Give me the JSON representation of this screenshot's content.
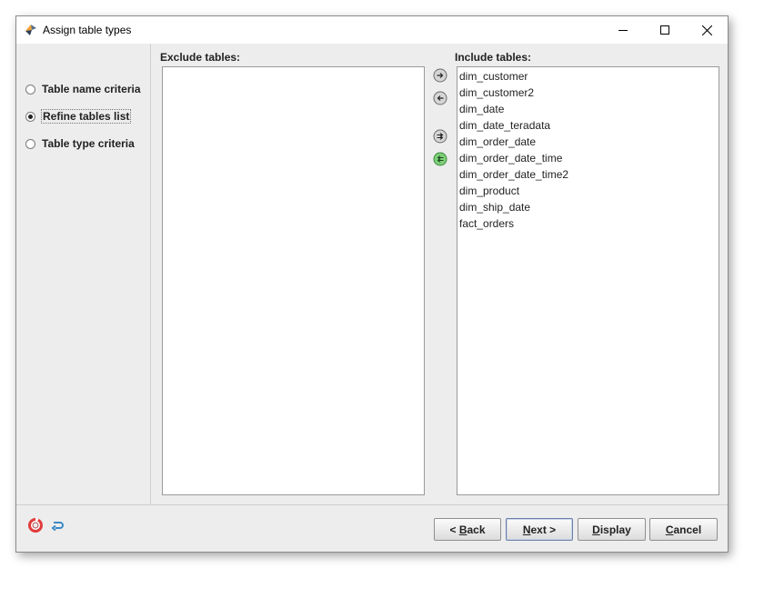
{
  "window": {
    "title": "Assign table types",
    "controls": {
      "minimize": "minimize-icon",
      "maximize": "maximize-icon",
      "close": "close-icon"
    }
  },
  "left_panel": {
    "options": [
      {
        "label": "Table name criteria",
        "selected": false
      },
      {
        "label": "Refine tables list",
        "selected": true
      },
      {
        "label": "Table type criteria",
        "selected": false
      }
    ]
  },
  "exclude": {
    "label": "Exclude tables:",
    "items": []
  },
  "include": {
    "label": "Include tables:",
    "items": [
      "dim_customer",
      "dim_customer2",
      "dim_date",
      "dim_date_teradata",
      "dim_order_date",
      "dim_order_date_time",
      "dim_order_date_time2",
      "dim_product",
      "dim_ship_date",
      "fact_orders"
    ]
  },
  "move_buttons": [
    "move-right-icon",
    "move-left-icon",
    "move-all-right-icon",
    "move-all-left-icon"
  ],
  "footer": {
    "icons": [
      "help-lifebuoy-icon",
      "undo-icon"
    ],
    "buttons": {
      "back": {
        "prefix": "< ",
        "mnemonic": "B",
        "rest": "ack"
      },
      "next": {
        "mnemonic": "N",
        "rest": "ext >"
      },
      "display": {
        "mnemonic": "D",
        "rest": "isplay"
      },
      "cancel": {
        "mnemonic": "C",
        "rest": "ancel"
      }
    }
  },
  "colors": {
    "accent_green": "#4caf50",
    "window_bg": "#ededed",
    "lifebuoy_red": "#e03a3a",
    "undo_blue": "#3a8ac4"
  }
}
